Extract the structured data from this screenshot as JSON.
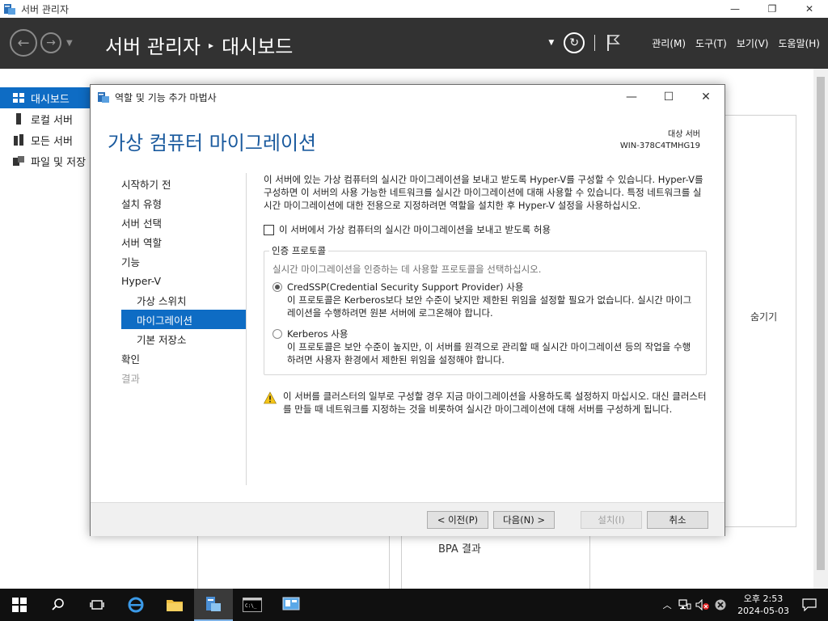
{
  "window": {
    "title": "서버 관리자"
  },
  "header": {
    "breadcrumb_root": "서버 관리자",
    "breadcrumb_sep": "▸",
    "breadcrumb_page": "대시보드",
    "menus": [
      {
        "label": "관리(M)"
      },
      {
        "label": "도구(T)"
      },
      {
        "label": "보기(V)"
      },
      {
        "label": "도움말(H)"
      }
    ]
  },
  "sidebar": {
    "items": [
      {
        "label": "대시보드",
        "icon": "dashboard-icon",
        "active": true
      },
      {
        "label": "로컬 서버",
        "icon": "server-icon"
      },
      {
        "label": "모든 서버",
        "icon": "servers-icon"
      },
      {
        "label": "파일 및 저장",
        "icon": "storage-icon"
      }
    ]
  },
  "dashboard": {
    "hide_label": "숨기기",
    "bpa_label": "BPA 결과"
  },
  "wizard": {
    "title": "역할 및 기능 추가 마법사",
    "heading": "가상 컴퓨터 마이그레이션",
    "dest_label": "대상 서버",
    "dest_server": "WIN-378C4TMHG19",
    "steps": [
      {
        "label": "시작하기 전"
      },
      {
        "label": "설치 유형"
      },
      {
        "label": "서버 선택"
      },
      {
        "label": "서버 역할"
      },
      {
        "label": "기능"
      },
      {
        "label": "Hyper-V"
      },
      {
        "label": "가상 스위치"
      },
      {
        "label": "마이그레이션"
      },
      {
        "label": "기본 저장소"
      },
      {
        "label": "확인"
      },
      {
        "label": "결과"
      }
    ],
    "intro": "이 서버에 있는 가상 컴퓨터의 실시간 마이그레이션을 보내고 받도록 Hyper-V를 구성할 수 있습니다. Hyper-V를 구성하면 이 서버의 사용 가능한 네트워크를 실시간 마이그레이션에 대해 사용할 수 있습니다. 특정 네트워크를 실시간 마이그레이션에 대한 전용으로 지정하려면 역할을 설치한 후 Hyper-V 설정을 사용하십시오.",
    "allow_checkbox_label": "이 서버에서 가상 컴퓨터의 실시간 마이그레이션을 보내고 받도록 허용",
    "allow_checked": false,
    "auth_group_label": "인증 프로토콜",
    "auth_desc": "실시간 마이그레이션을 인증하는 데 사용할 프로토콜을 선택하십시오.",
    "credssp_label": "CredSSP(Credential Security Support Provider) 사용",
    "credssp_desc": "이 프로토콜은 Kerberos보다 보안 수준이 낮지만 제한된 위임을 설정할 필요가 없습니다. 실시간 마이그레이션을 수행하려면 원본 서버에 로그온해야 합니다.",
    "kerberos_label": "Kerberos 사용",
    "kerberos_desc": "이 프로토콜은 보안 수준이 높지만, 이 서버를 원격으로 관리할 때 실시간 마이그레이션 등의 작업을 수행하려면 사용자 환경에서 제한된 위임을 설정해야 합니다.",
    "warning": "이 서버를 클러스터의 일부로 구성할 경우 지금 마이그레이션을 사용하도록 설정하지 마십시오. 대신 클러스터를 만들 때 네트워크를 지정하는 것을 비롯하여 실시간 마이그레이션에 대해 서버를 구성하게 됩니다.",
    "buttons": {
      "prev": "< 이전(P)",
      "next": "다음(N) >",
      "install": "설치(I)",
      "cancel": "취소"
    }
  },
  "taskbar": {
    "time": "오후 2:53",
    "date": "2024-05-03"
  },
  "colors": {
    "accent": "#0e6cc4",
    "heading": "#1a5a9e",
    "header_bg": "#323232"
  }
}
